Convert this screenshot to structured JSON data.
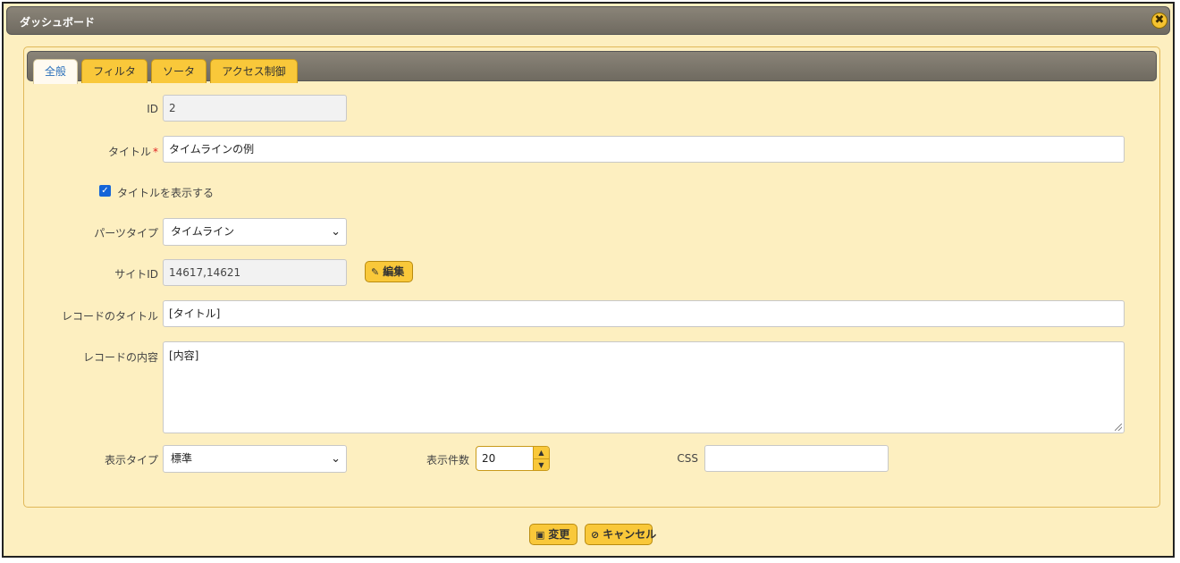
{
  "dialog": {
    "title": "ダッシュボード",
    "close_icon": "✖"
  },
  "tabs": [
    {
      "label": "全般",
      "active": true
    },
    {
      "label": "フィルタ"
    },
    {
      "label": "ソータ"
    },
    {
      "label": "アクセス制御"
    }
  ],
  "form": {
    "id": {
      "label": "ID",
      "value": "2"
    },
    "title": {
      "label": "タイトル",
      "required_mark": "*",
      "value": "タイムラインの例"
    },
    "show_title": {
      "label": "タイトルを表示する",
      "checked": true
    },
    "part_type": {
      "label": "パーツタイプ",
      "value": "タイムライン"
    },
    "site_id": {
      "label": "サイトID",
      "value": "14617,14621",
      "edit_button": "編集"
    },
    "record_title": {
      "label": "レコードのタイトル",
      "value": "[タイトル]"
    },
    "record_body": {
      "label": "レコードの内容",
      "value": "[内容]"
    },
    "display_type": {
      "label": "表示タイプ",
      "value": "標準"
    },
    "display_count": {
      "label": "表示件数",
      "value": "20"
    },
    "css": {
      "label": "CSS",
      "value": ""
    }
  },
  "footer": {
    "update_button": "変更",
    "cancel_button": "キャンセル"
  },
  "colors": {
    "accent": "#f9c83a",
    "background": "#fdefc0",
    "header": "#7a756b",
    "active_tab_text": "#2a6fba"
  }
}
